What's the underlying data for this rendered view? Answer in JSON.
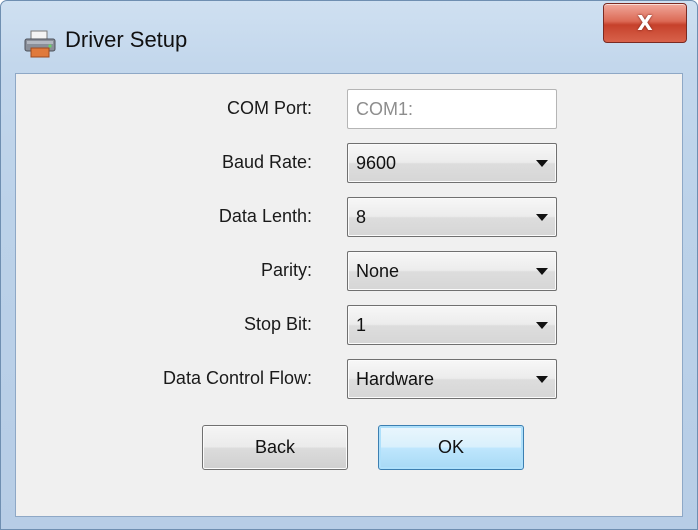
{
  "window": {
    "title": "Driver Setup",
    "close_label": "X"
  },
  "form": {
    "com_port": {
      "label": "COM Port:",
      "value": "COM1:"
    },
    "baud_rate": {
      "label": "Baud Rate:",
      "value": "9600"
    },
    "data_length": {
      "label": "Data Lenth:",
      "value": "8"
    },
    "parity": {
      "label": "Parity:",
      "value": "None"
    },
    "stop_bit": {
      "label": "Stop Bit:",
      "value": "1"
    },
    "flow_control": {
      "label": "Data Control Flow:",
      "value": "Hardware"
    }
  },
  "buttons": {
    "back_label": "Back",
    "ok_label": "OK"
  },
  "icons": {
    "app": "printer-icon",
    "close": "close-icon",
    "dropdown": "chevron-down-icon"
  },
  "colors": {
    "titlebar": "#c3d7ec",
    "close_button": "#c6412b",
    "ok_button_accent": "#3c7fb1",
    "client_bg": "#f0f0f0"
  }
}
